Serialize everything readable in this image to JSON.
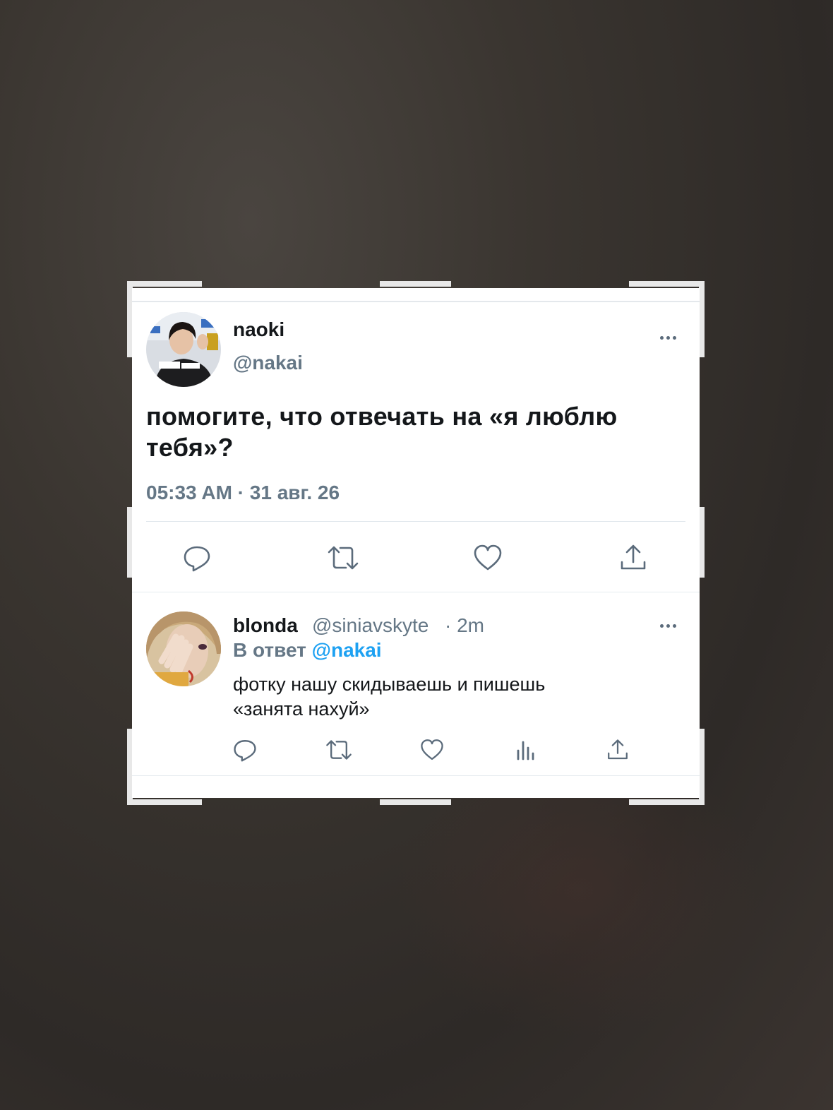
{
  "main_tweet": {
    "display_name": "naoki",
    "handle": "@nakai",
    "text": "помогите, что отвечать на «я люблю тебя»?",
    "timestamp": "05:33 AM · 31 авг. 26"
  },
  "reply": {
    "display_name": "blonda",
    "handle": "@siniavskyte",
    "time": "· 2m",
    "reply_prefix": "В ответ",
    "reply_to": "@nakai",
    "text_line1": "фотку нашу скидываешь и пишешь",
    "text_line2": "«занята нахуй»"
  },
  "icons": {
    "main_actions": [
      "reply-icon",
      "retweet-icon",
      "like-icon",
      "share-icon"
    ],
    "reply_actions": [
      "reply-icon",
      "retweet-icon",
      "like-icon",
      "analytics-icon",
      "share-icon"
    ],
    "more": "more-icon"
  },
  "colors": {
    "text": "#14171a",
    "secondary": "#657786",
    "link": "#1da1f2",
    "icon": "#5b6b7b"
  }
}
